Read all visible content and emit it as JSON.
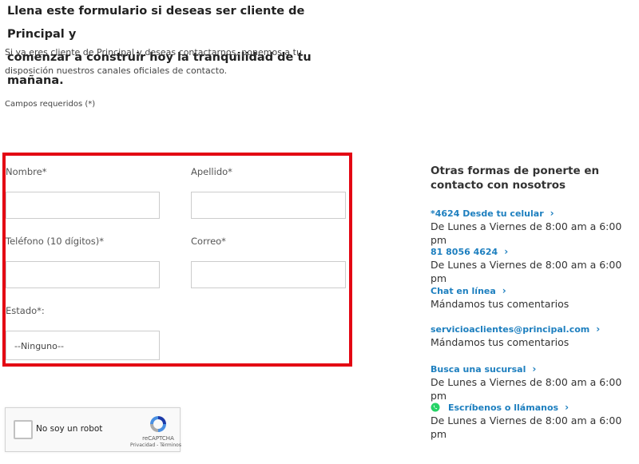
{
  "heading": {
    "line1": "Llena este formulario si deseas ser cliente de Principal y",
    "line2": "comenzar a construir hoy la tranquilidad de tu mañana."
  },
  "intro": {
    "line1": "Si ya eres cliente de Principal y deseas contactarnos, ponemos a tu",
    "line2": "disposición nuestros canales oficiales de contacto."
  },
  "required_note": "Campos requeridos (*)",
  "form": {
    "nombre_label": "Nombre*",
    "apellido_label": "Apellido*",
    "telefono_label": "Teléfono (10 dígitos)*",
    "correo_label": "Correo*",
    "estado_label": "Estado*:",
    "estado_selected": "--Ninguno--",
    "nombre_value": "",
    "apellido_value": "",
    "telefono_value": "",
    "correo_value": ""
  },
  "captcha": {
    "label": "No soy un robot",
    "brand": "reCAPTCHA",
    "links": "Privacidad - Términos"
  },
  "sidebar": {
    "title": "Otras formas de ponerte en contacto con nosotros",
    "items": [
      {
        "link": "*4624 Desde tu celular",
        "desc": "De Lunes a Viernes de 8:00 am a 6:00 pm",
        "icon": "chevron-right-icon"
      },
      {
        "link": "81 8056 4624",
        "desc": "De Lunes a Viernes de 8:00 am a 6:00 pm",
        "icon": "chevron-right-icon"
      },
      {
        "link": "Chat en línea",
        "desc": "Mándamos tus comentarios",
        "icon": "chevron-right-icon"
      },
      {
        "link": "servicioaclientes@principal.com",
        "desc": "Mándamos tus comentarios",
        "icon": "chevron-right-icon"
      },
      {
        "link": "Busca una sucursal",
        "desc": "De Lunes a Viernes de 8:00 am a 6:00 pm",
        "icon": "chevron-right-icon"
      },
      {
        "link": "Escríbenos o llámanos",
        "desc": "De Lunes a Viernes de 8:00 am a 6:00 pm",
        "icon": "whatsapp-icon"
      }
    ]
  },
  "colors": {
    "highlight_border": "#e30613",
    "link": "#1d7fbf",
    "whatsapp": "#25d366"
  }
}
